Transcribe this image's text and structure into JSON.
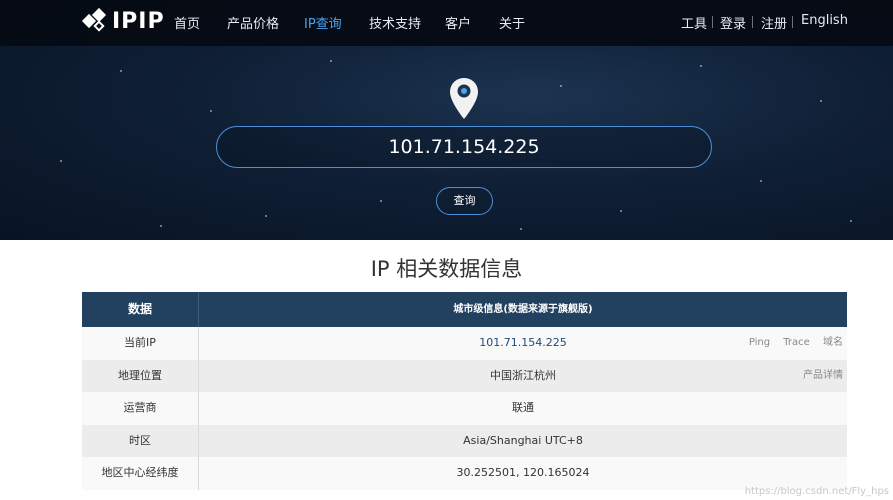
{
  "brand": {
    "logo_text": "IPIP"
  },
  "nav": {
    "left": [
      "首页",
      "产品价格",
      "IP查询",
      "技术支持",
      "客户",
      "关于"
    ],
    "active": "IP查询",
    "right": [
      "工具",
      "登录",
      "注册",
      "English"
    ]
  },
  "search": {
    "value": "101.71.154.225",
    "button_label": "查询"
  },
  "section_title": "IP 相关数据信息",
  "table": {
    "header": {
      "col1": "数据",
      "col2": "城市级信息(数据来源于旗舰版)"
    },
    "rows": [
      {
        "label": "当前IP",
        "value": "101.71.154.225",
        "actions": [
          "Ping",
          "Trace",
          "域名"
        ]
      },
      {
        "label": "地理位置",
        "value": "中国浙江杭州",
        "actions": [
          "产品详情"
        ]
      },
      {
        "label": "运营商",
        "value": "联通",
        "actions": []
      },
      {
        "label": "时区",
        "value": "Asia/Shanghai UTC+8",
        "actions": []
      },
      {
        "label": "地区中心经纬度",
        "value": "30.252501, 120.165024",
        "actions": []
      }
    ]
  },
  "watermark": "https://blog.csdn.net/Fly_hps",
  "colors": {
    "nav_active": "#4aa3f0",
    "table_header_bg": "#22405f",
    "accent_border": "#4d8fd6"
  }
}
